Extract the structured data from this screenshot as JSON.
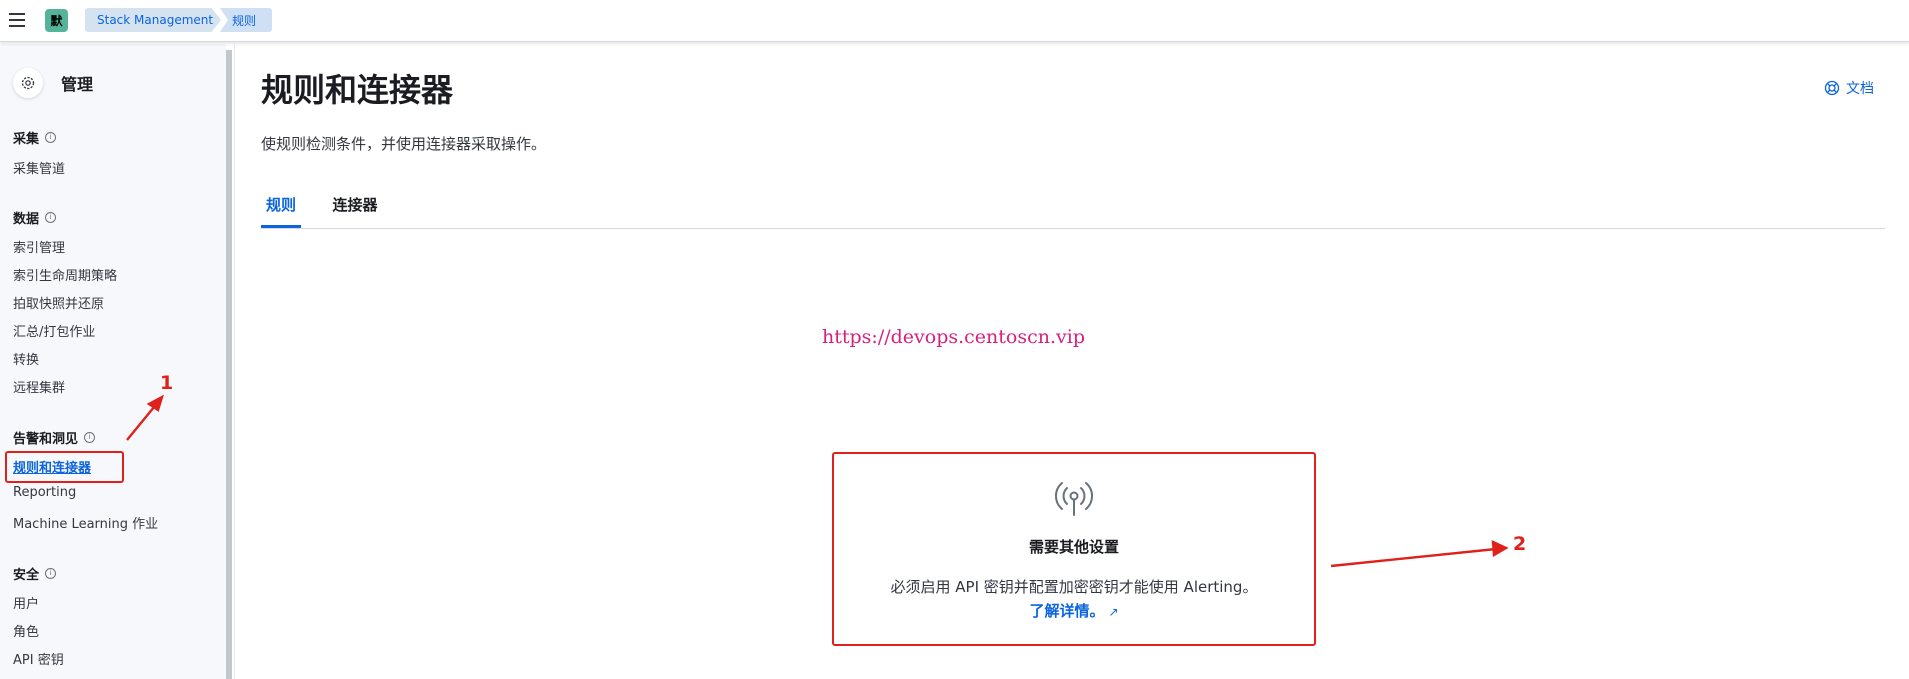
{
  "header": {
    "space_initial": "默",
    "breadcrumbs": [
      "Stack Management",
      "规则"
    ]
  },
  "sidebar": {
    "title": "管理",
    "groups": [
      {
        "title": "采集",
        "items": [
          "采集管道"
        ]
      },
      {
        "title": "数据",
        "items": [
          "索引管理",
          "索引生命周期策略",
          "拍取快照并还原",
          "汇总/打包作业",
          "转换",
          "远程集群"
        ]
      },
      {
        "title": "告警和洞见",
        "items": [
          "规则和连接器",
          "Reporting",
          "Machine Learning 作业"
        ]
      },
      {
        "title": "安全",
        "items": [
          "用户",
          "角色",
          "API 密钥"
        ]
      }
    ],
    "active_item": "规则和连接器"
  },
  "main": {
    "title": "规则和连接器",
    "docs_link": "文档",
    "description": "使规则检测条件，并使用连接器采取操作。",
    "tabs": [
      "规则",
      "连接器"
    ],
    "active_tab": "规则",
    "watermark": "https://devops.centoscn.vip",
    "prompt": {
      "icon": "broadcast-icon",
      "title": "需要其他设置",
      "body": "必须启用 API 密钥并配置加密密钥才能使用 Alerting。",
      "link": "了解详情。"
    }
  },
  "annotations": {
    "marker_1": "1",
    "marker_2": "2"
  },
  "colors": {
    "accent": "#0b64dd",
    "annotation": "#e0201b",
    "watermark": "#d6207e",
    "space_avatar": "#54b399"
  }
}
